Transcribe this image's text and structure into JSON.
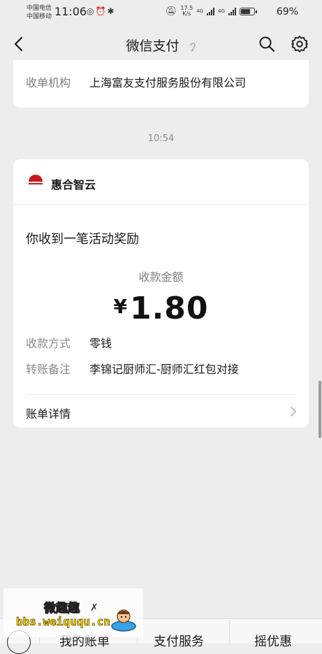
{
  "status_bar": {
    "carrier1": "中国电信",
    "carrier2": "中国移动",
    "time": "11:06",
    "net_speed_value": "17.5",
    "net_speed_unit": "K/s",
    "net_type_1": "4G",
    "net_type_2": "4G",
    "battery": "69%"
  },
  "titlebar": {
    "title": "微信支付",
    "back_icon": "chevron-left-icon",
    "search_icon": "search-icon",
    "settings_icon": "gear-icon"
  },
  "previous_card": {
    "label": "收单机构",
    "value": "上海富友支付服务股份有限公司"
  },
  "timestamp": "10:54",
  "message_card": {
    "merchant_name": "惠合智云",
    "notice": "你收到一笔活动奖励",
    "amount_label": "收款金额",
    "currency_symbol": "¥",
    "amount": "1.80",
    "details": [
      {
        "label": "收款方式",
        "value": "零钱"
      },
      {
        "label": "转账备注",
        "value": "李锦记厨师汇-厨师汇红包对接"
      }
    ],
    "bill_detail_label": "账单详情"
  },
  "bottom_bar": {
    "tabs": [
      "我的账单",
      "支付服务",
      "摇优惠"
    ]
  },
  "watermark": {
    "title": "微趣趣",
    "url": "bbs.weiququ.cn"
  },
  "colors": {
    "background": "#ededed",
    "card": "#ffffff",
    "logo_red": "#c8191e"
  }
}
